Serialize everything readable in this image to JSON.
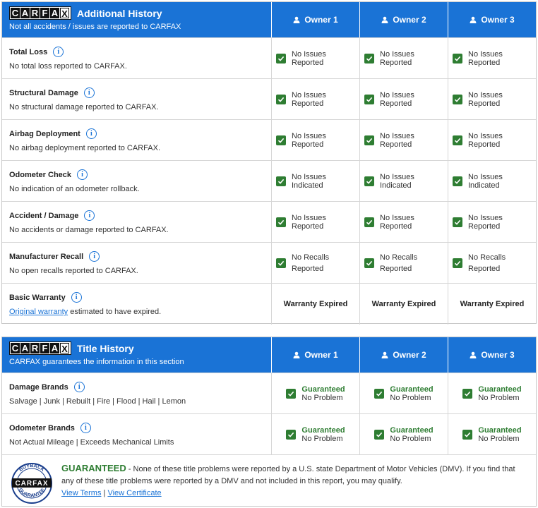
{
  "logo_letters": [
    "C",
    "A",
    "R",
    "F",
    "A",
    "X"
  ],
  "additional": {
    "title": "Additional History",
    "subtitle": "Not all accidents / issues are reported to CARFAX",
    "owners": [
      "Owner 1",
      "Owner 2",
      "Owner 3"
    ],
    "rows": [
      {
        "title": "Total Loss",
        "desc": "No total loss reported to CARFAX.",
        "status": "No Issues Reported"
      },
      {
        "title": "Structural Damage",
        "desc": "No structural damage reported to CARFAX.",
        "status": "No Issues Reported"
      },
      {
        "title": "Airbag Deployment",
        "desc": "No airbag deployment reported to CARFAX.",
        "status": "No Issues Reported"
      },
      {
        "title": "Odometer Check",
        "desc": "No indication of an odometer rollback.",
        "status": "No Issues Indicated"
      },
      {
        "title": "Accident / Damage",
        "desc": "No accidents or damage reported to CARFAX.",
        "status": "No Issues Reported"
      },
      {
        "title": "Manufacturer Recall",
        "desc": "No open recalls reported to CARFAX.",
        "status_line1": "No Recalls",
        "status_line2": "Reported"
      },
      {
        "title": "Basic Warranty",
        "desc_link": "Original warranty",
        "desc_rest": " estimated to have expired.",
        "status": "Warranty Expired"
      }
    ]
  },
  "title_history": {
    "title": "Title History",
    "subtitle": "CARFAX guarantees the information in this section",
    "owners": [
      "Owner 1",
      "Owner 2",
      "Owner 3"
    ],
    "rows": [
      {
        "title": "Damage Brands",
        "desc": "Salvage | Junk | Rebuilt | Fire | Flood | Hail | Lemon",
        "guaranteed": "Guaranteed",
        "result": "No Problem"
      },
      {
        "title": "Odometer Brands",
        "desc": "Not Actual Mileage | Exceeds Mechanical Limits",
        "guaranteed": "Guaranteed",
        "result": "No Problem"
      }
    ],
    "footer": {
      "heading": "GUARANTEED",
      "text": " - None of these title problems were reported by a U.S. state Department of Motor Vehicles (DMV). If you find that any of these title problems were reported by a DMV and not included in this report, you may qualify.",
      "view_terms": "View Terms",
      "separator": " | ",
      "view_certificate": "View Certificate",
      "seal_top": "BUYBACK",
      "seal_bottom": "GUARANTEE"
    }
  },
  "colors": {
    "header_blue": "#1a73d6",
    "check_green": "#2e7d32"
  }
}
